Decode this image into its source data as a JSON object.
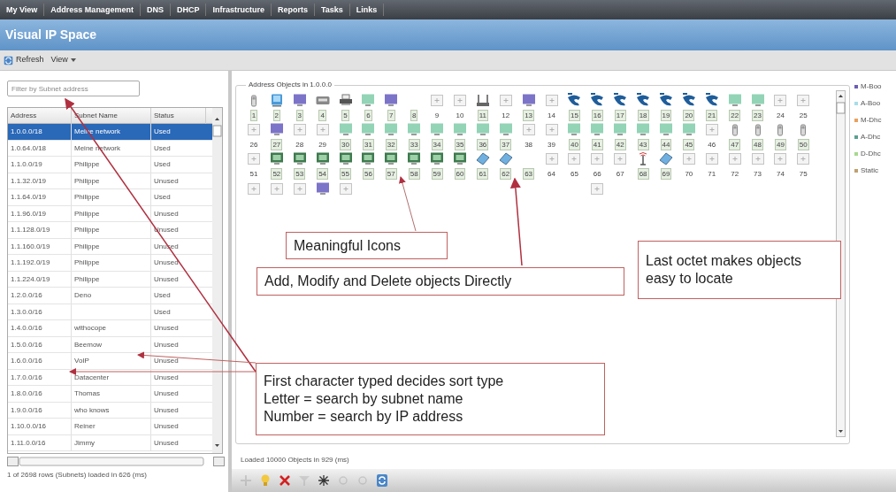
{
  "nav": [
    {
      "label": "My View"
    },
    {
      "label": "Address Management"
    },
    {
      "label": "DNS"
    },
    {
      "label": "DHCP"
    },
    {
      "label": "Infrastructure"
    },
    {
      "label": "Reports"
    },
    {
      "label": "Tasks"
    },
    {
      "label": "Links"
    }
  ],
  "page_title": "Visual IP Space",
  "toolbar": {
    "refresh": "Refresh",
    "view": "View"
  },
  "filter": {
    "placeholder": "Filter by Subnet address"
  },
  "table": {
    "columns": [
      "Address",
      "Subnet Name",
      "Status"
    ],
    "rows": [
      {
        "address": "1.0.0.0/18",
        "name": "Meine network",
        "status": "Used",
        "selected": true
      },
      {
        "address": "1.0.64.0/18",
        "name": "Meine network",
        "status": "Used",
        "selected": false
      },
      {
        "address": "1.1.0.0/19",
        "name": "Philippe",
        "status": "Used",
        "selected": false
      },
      {
        "address": "1.1.32.0/19",
        "name": "Philippe",
        "status": "Unused",
        "selected": false
      },
      {
        "address": "1.1.64.0/19",
        "name": "Philippe",
        "status": "Used",
        "selected": false
      },
      {
        "address": "1.1.96.0/19",
        "name": "Philippe",
        "status": "Unused",
        "selected": false
      },
      {
        "address": "1.1.128.0/19",
        "name": "Philippe",
        "status": "Unused",
        "selected": false
      },
      {
        "address": "1.1.160.0/19",
        "name": "Philippe",
        "status": "Unused",
        "selected": false
      },
      {
        "address": "1.1.192.0/19",
        "name": "Philippe",
        "status": "Unused",
        "selected": false
      },
      {
        "address": "1.1.224.0/19",
        "name": "Philippe",
        "status": "Unused",
        "selected": false
      },
      {
        "address": "1.2.0.0/16",
        "name": "Deno",
        "status": "Used",
        "selected": false
      },
      {
        "address": "1.3.0.0/16",
        "status": "Used",
        "selected": false
      },
      {
        "address": "1.4.0.0/16",
        "name": "withocope",
        "status": "Unused",
        "selected": false
      },
      {
        "address": "1.5.0.0/16",
        "name": "Beemow",
        "status": "Unused",
        "selected": false
      },
      {
        "address": "1.6.0.0/16",
        "name": "VoIP",
        "status": "Unused",
        "selected": false
      },
      {
        "address": "1.7.0.0/16",
        "name": "Datacenter",
        "status": "Unused",
        "selected": false
      },
      {
        "address": "1.8.0.0/16",
        "name": "Thomas",
        "status": "Unused",
        "selected": false
      },
      {
        "address": "1.9.0.0/16",
        "name": "who knows",
        "status": "Unused",
        "selected": false
      },
      {
        "address": "1.10.0.0/16",
        "name": "Reiner",
        "status": "Unused",
        "selected": false
      },
      {
        "address": "1.11.0.0/16",
        "name": "Jimmy",
        "status": "Unused",
        "selected": false
      }
    ],
    "status": "1 of 2698 rows (Subnets) loaded in 626 (ms)"
  },
  "objects": {
    "title": "Address Objects in 1.0.0.0",
    "rows": [
      [
        {
          "kind": "handheld",
          "label": "1",
          "boxed": true
        },
        {
          "kind": "computer",
          "label": "2",
          "boxed": true
        },
        {
          "kind": "monitor",
          "color": "#7c74c8",
          "label": "3",
          "boxed": true
        },
        {
          "kind": "scanner",
          "label": "4",
          "boxed": true
        },
        {
          "kind": "printer",
          "label": "5",
          "boxed": true
        },
        {
          "kind": "monitor",
          "color": "#93d3b6",
          "label": "6",
          "boxed": true
        },
        {
          "kind": "monitor",
          "color": "#7c74c8",
          "label": "7",
          "boxed": true
        },
        {
          "kind": "none",
          "label": "8",
          "boxed": true
        },
        {
          "kind": "empty-slot",
          "label": "9",
          "boxed": false
        },
        {
          "kind": "empty-slot",
          "label": "10",
          "boxed": false
        },
        {
          "kind": "router",
          "label": "11",
          "boxed": true
        },
        {
          "kind": "empty-slot",
          "label": "12",
          "boxed": false
        },
        {
          "kind": "monitor",
          "color": "#7c74c8",
          "label": "13",
          "boxed": true
        },
        {
          "kind": "empty-slot",
          "label": "14",
          "boxed": false
        },
        {
          "kind": "sip-phone",
          "label": "15",
          "boxed": true
        },
        {
          "kind": "sip-phone",
          "label": "16",
          "boxed": true
        },
        {
          "kind": "sip-phone",
          "label": "17",
          "boxed": true
        },
        {
          "kind": "sip-phone",
          "label": "18",
          "boxed": true
        },
        {
          "kind": "sip-phone",
          "label": "19",
          "boxed": true
        },
        {
          "kind": "sip-phone",
          "label": "20",
          "boxed": true
        },
        {
          "kind": "sip-phone",
          "label": "21",
          "boxed": true
        },
        {
          "kind": "monitor",
          "color": "#93d3b6",
          "label": "22",
          "boxed": true
        },
        {
          "kind": "monitor",
          "color": "#93d3b6",
          "label": "23",
          "boxed": true
        },
        {
          "kind": "empty-slot",
          "label": "24",
          "boxed": false
        },
        {
          "kind": "empty-slot",
          "label": "25",
          "boxed": false
        }
      ],
      [
        {
          "kind": "empty-slot",
          "label": "26",
          "boxed": false
        },
        {
          "kind": "monitor",
          "color": "#7c74c8",
          "label": "27",
          "boxed": true
        },
        {
          "kind": "empty-slot",
          "label": "28",
          "boxed": false
        },
        {
          "kind": "empty-slot",
          "label": "29",
          "boxed": false
        },
        {
          "kind": "monitor",
          "color": "#93d3b6",
          "label": "30",
          "boxed": true
        },
        {
          "kind": "monitor",
          "color": "#93d3b6",
          "label": "31",
          "boxed": true
        },
        {
          "kind": "monitor",
          "color": "#93d3b6",
          "label": "32",
          "boxed": true
        },
        {
          "kind": "monitor",
          "color": "#93d3b6",
          "label": "33",
          "boxed": true
        },
        {
          "kind": "monitor",
          "color": "#93d3b6",
          "label": "34",
          "boxed": true
        },
        {
          "kind": "monitor",
          "color": "#93d3b6",
          "label": "35",
          "boxed": true
        },
        {
          "kind": "monitor",
          "color": "#93d3b6",
          "label": "36",
          "boxed": true
        },
        {
          "kind": "monitor",
          "color": "#93d3b6",
          "label": "37",
          "boxed": true
        },
        {
          "kind": "empty-slot",
          "label": "38",
          "boxed": false
        },
        {
          "kind": "empty-slot",
          "label": "39",
          "boxed": false
        },
        {
          "kind": "monitor",
          "color": "#93d3b6",
          "label": "40",
          "boxed": true
        },
        {
          "kind": "monitor",
          "color": "#93d3b6",
          "label": "41",
          "boxed": true
        },
        {
          "kind": "monitor",
          "color": "#93d3b6",
          "label": "42",
          "boxed": true
        },
        {
          "kind": "monitor",
          "color": "#93d3b6",
          "label": "43",
          "boxed": true
        },
        {
          "kind": "monitor",
          "color": "#93d3b6",
          "label": "44",
          "boxed": true
        },
        {
          "kind": "monitor",
          "color": "#93d3b6",
          "label": "45",
          "boxed": true
        },
        {
          "kind": "empty-slot",
          "label": "46",
          "boxed": false
        },
        {
          "kind": "handheld",
          "label": "47",
          "boxed": true
        },
        {
          "kind": "handheld",
          "label": "48",
          "boxed": true
        },
        {
          "kind": "handheld",
          "label": "49",
          "boxed": true
        },
        {
          "kind": "handheld",
          "label": "50",
          "boxed": true
        }
      ],
      [
        {
          "kind": "empty-slot",
          "label": "51",
          "boxed": false
        },
        {
          "kind": "server",
          "label": "52",
          "boxed": true
        },
        {
          "kind": "server",
          "label": "53",
          "boxed": true
        },
        {
          "kind": "server",
          "label": "54",
          "boxed": true
        },
        {
          "kind": "server",
          "label": "55",
          "boxed": true
        },
        {
          "kind": "server",
          "label": "56",
          "boxed": true
        },
        {
          "kind": "server",
          "label": "57",
          "boxed": true
        },
        {
          "kind": "server",
          "label": "58",
          "boxed": true
        },
        {
          "kind": "server",
          "label": "59",
          "boxed": true
        },
        {
          "kind": "server",
          "label": "60",
          "boxed": true
        },
        {
          "kind": "tablet",
          "label": "61",
          "boxed": true
        },
        {
          "kind": "tablet",
          "label": "62",
          "boxed": true
        },
        {
          "kind": "none",
          "label": "63",
          "boxed": true
        },
        {
          "kind": "empty-slot",
          "label": "64",
          "boxed": false
        },
        {
          "kind": "empty-slot",
          "label": "65",
          "boxed": false
        },
        {
          "kind": "empty-slot",
          "label": "66",
          "boxed": false
        },
        {
          "kind": "empty-slot",
          "label": "67",
          "boxed": false
        },
        {
          "kind": "antenna",
          "label": "68",
          "boxed": true
        },
        {
          "kind": "tablet",
          "label": "69",
          "boxed": true
        },
        {
          "kind": "empty-slot",
          "label": "70",
          "boxed": false
        },
        {
          "kind": "empty-slot",
          "label": "71",
          "boxed": false
        },
        {
          "kind": "empty-slot",
          "label": "72",
          "boxed": false
        },
        {
          "kind": "empty-slot",
          "label": "73",
          "boxed": false
        },
        {
          "kind": "empty-slot",
          "label": "74",
          "boxed": false
        },
        {
          "kind": "empty-slot",
          "label": "75",
          "boxed": false
        }
      ],
      [
        {
          "kind": "empty-slot"
        },
        {
          "kind": "empty-slot"
        },
        {
          "kind": "empty-slot"
        },
        {
          "kind": "monitor",
          "color": "#7c74c8"
        },
        {
          "kind": "empty-slot"
        },
        {
          "kind": "none"
        },
        {
          "kind": "none"
        },
        {
          "kind": "none"
        },
        {
          "kind": "none"
        },
        {
          "kind": "none"
        },
        {
          "kind": "none"
        },
        {
          "kind": "none"
        },
        {
          "kind": "none"
        },
        {
          "kind": "none"
        },
        {
          "kind": "none"
        },
        {
          "kind": "empty-slot"
        }
      ]
    ],
    "status": "Loaded 10000 Objects in 929 (ms)"
  },
  "legend": [
    {
      "label": "M-Boo",
      "color": "#6b5fb5"
    },
    {
      "label": "A-Boo",
      "color": "#a8dde8"
    },
    {
      "label": "M-Dhc",
      "color": "#e8a060"
    },
    {
      "label": "A-Dhc",
      "color": "#5aa090"
    },
    {
      "label": "D-Dhc",
      "color": "#a8d890"
    },
    {
      "label": "Static",
      "color": "#c0a070"
    }
  ],
  "tools": [
    {
      "kind": "add",
      "disabled": true
    },
    {
      "kind": "edit",
      "disabled": false
    },
    {
      "kind": "delete",
      "disabled": false
    },
    {
      "kind": "filter",
      "disabled": true
    },
    {
      "kind": "asterisk",
      "disabled": false
    },
    {
      "kind": "circle",
      "disabled": true
    },
    {
      "kind": "circle",
      "disabled": true
    },
    {
      "kind": "refresh",
      "disabled": false
    }
  ],
  "callouts": [
    {
      "lines": [
        "Meaningful Icons"
      ]
    },
    {
      "lines": [
        "Add, Modify and Delete objects Directly"
      ]
    },
    {
      "lines": [
        "Last octet makes objects easy to locate"
      ]
    },
    {
      "lines": [
        "First character typed decides sort type",
        "Letter = search by subnet name",
        "Number = search by IP address"
      ]
    }
  ]
}
